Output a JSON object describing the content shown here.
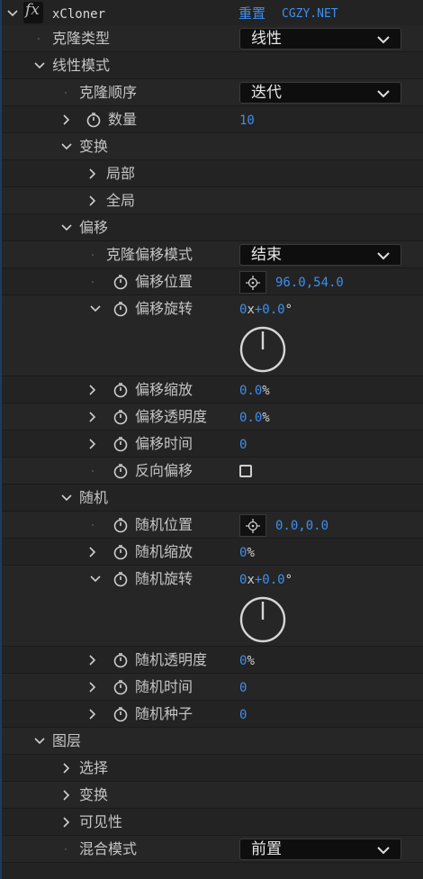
{
  "effect": {
    "fx_label": "fx",
    "name": "xCloner",
    "reset_label": "重置",
    "watermark": "CGZY.NET"
  },
  "rows": {
    "clone_type": {
      "label": "克隆类型",
      "value": "线性"
    },
    "linear_mode": {
      "label": "线性模式"
    },
    "clone_order": {
      "label": "克隆顺序",
      "value": "迭代"
    },
    "count": {
      "label": "数量",
      "value": "10"
    },
    "transform": {
      "label": "变换"
    },
    "local": {
      "label": "局部"
    },
    "global": {
      "label": "全局"
    },
    "offset": {
      "label": "偏移"
    },
    "clone_offset_mode": {
      "label": "克隆偏移模式",
      "value": "结束"
    },
    "offset_position": {
      "label": "偏移位置",
      "value": "96.0,54.0"
    },
    "offset_rotation": {
      "label": "偏移旋转",
      "value_prefix": "0",
      "value_x": "x",
      "value_rest": "+0.0",
      "value_deg": "°"
    },
    "offset_scale": {
      "label": "偏移缩放",
      "value": "0.0",
      "unit": "%"
    },
    "offset_opacity": {
      "label": "偏移透明度",
      "value": "0.0",
      "unit": "%"
    },
    "offset_time": {
      "label": "偏移时间",
      "value": "0"
    },
    "reverse_offset": {
      "label": "反向偏移",
      "checked": false
    },
    "random": {
      "label": "随机"
    },
    "random_position": {
      "label": "随机位置",
      "value": "0.0,0.0"
    },
    "random_scale": {
      "label": "随机缩放",
      "value": "0",
      "unit": "%"
    },
    "random_rotation": {
      "label": "随机旋转",
      "value_prefix": "0",
      "value_x": "x",
      "value_rest": "+0.0",
      "value_deg": "°"
    },
    "random_opacity": {
      "label": "随机透明度",
      "value": "0",
      "unit": "%"
    },
    "random_time": {
      "label": "随机时间",
      "value": "0"
    },
    "random_seed": {
      "label": "随机种子",
      "value": "0"
    },
    "layer": {
      "label": "图层"
    },
    "select": {
      "label": "选择"
    },
    "layer_transform": {
      "label": "变换"
    },
    "visibility": {
      "label": "可见性"
    },
    "blend_mode": {
      "label": "混合模式",
      "value": "前置"
    }
  },
  "colors": {
    "background": "#232323",
    "value_blue": "#3d8ff0",
    "text": "#c4c4c4"
  }
}
